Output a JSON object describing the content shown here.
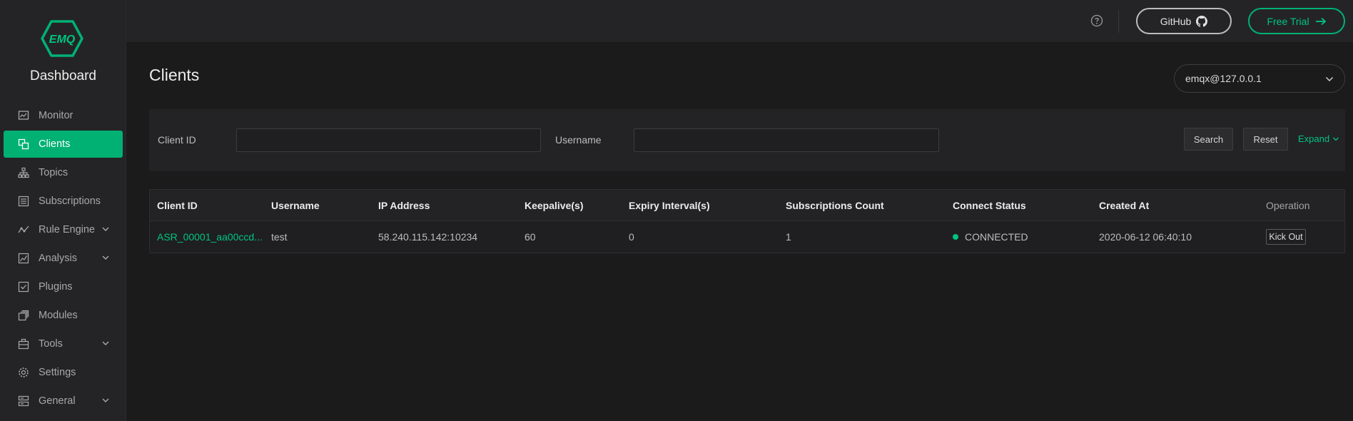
{
  "brand": {
    "logo_text": "EMQ",
    "name": "Dashboard",
    "accent": "#00b173"
  },
  "sidebar": {
    "items": [
      {
        "label": "Monitor",
        "icon": "monitor-icon"
      },
      {
        "label": "Clients",
        "icon": "clients-icon",
        "active": true
      },
      {
        "label": "Topics",
        "icon": "topics-icon"
      },
      {
        "label": "Subscriptions",
        "icon": "subscriptions-icon"
      },
      {
        "label": "Rule Engine",
        "icon": "rule-engine-icon",
        "expandable": true
      },
      {
        "label": "Analysis",
        "icon": "analysis-icon",
        "expandable": true
      },
      {
        "label": "Plugins",
        "icon": "plugins-icon"
      },
      {
        "label": "Modules",
        "icon": "modules-icon"
      },
      {
        "label": "Tools",
        "icon": "tools-icon",
        "expandable": true
      },
      {
        "label": "Settings",
        "icon": "settings-icon"
      },
      {
        "label": "General",
        "icon": "general-icon",
        "expandable": true
      }
    ]
  },
  "topbar": {
    "help_icon": "help-icon",
    "github_label": "GitHub",
    "trial_label": "Free Trial"
  },
  "page": {
    "title": "Clients",
    "node_select": {
      "value": "emqx@127.0.0.1"
    }
  },
  "search": {
    "client_id_label": "Client ID",
    "client_id_value": "",
    "username_label": "Username",
    "username_value": "",
    "search_label": "Search",
    "reset_label": "Reset",
    "expand_label": "Expand"
  },
  "table": {
    "columns": [
      "Client ID",
      "Username",
      "IP Address",
      "Keepalive(s)",
      "Expiry Interval(s)",
      "Subscriptions Count",
      "Connect Status",
      "Created At",
      "Operation"
    ],
    "rows": [
      {
        "client_id": "ASR_00001_aa00ccd...",
        "username": "test",
        "ip_address": "58.240.115.142:10234",
        "keepalive": "60",
        "expiry_interval": "0",
        "subscriptions_count": "1",
        "connect_status": "CONNECTED",
        "created_at": "2020-06-12 06:40:10",
        "operation_label": "Kick Out"
      }
    ]
  },
  "colors": {
    "status_connected": "#00c47f",
    "link": "#00c47f"
  }
}
